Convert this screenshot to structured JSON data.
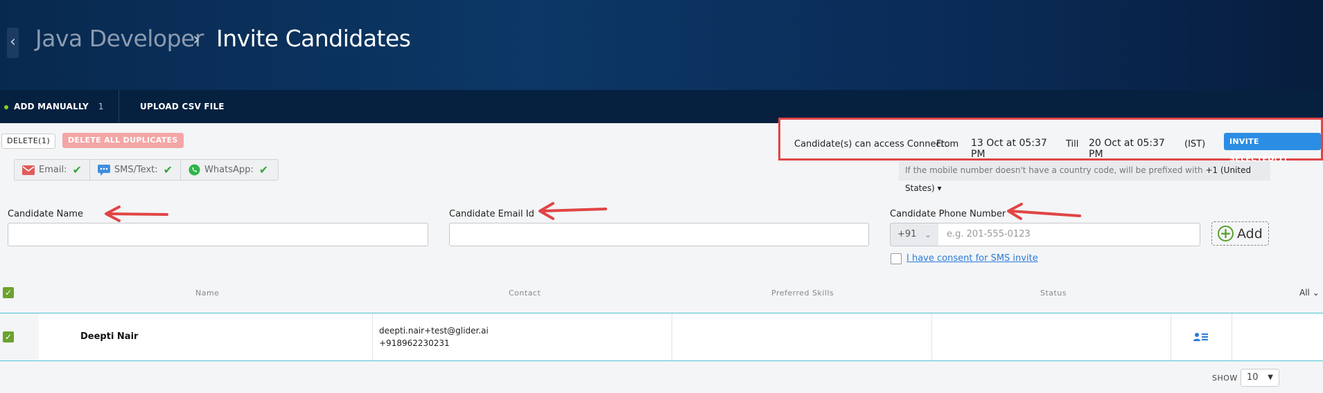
{
  "header": {
    "back_glyph": "‹",
    "breadcrumb_parent": "Java Developer",
    "breadcrumb_separator": "›",
    "page_title": "Invite Candidates"
  },
  "tabs": {
    "add_manually_label": "ADD MANUALLY",
    "add_manually_count": "1",
    "upload_csv_label": "UPLOAD CSV FILE"
  },
  "toolbar": {
    "delete_label": "DELETE(1)",
    "delete_duplicates_label": "DELETE ALL DUPLICATES"
  },
  "channels": [
    {
      "label": "Email:",
      "enabled": true
    },
    {
      "label": "SMS/Text:",
      "enabled": true
    },
    {
      "label": "WhatsApp:",
      "enabled": true
    }
  ],
  "access": {
    "label": "Candidate(s) can access Connect:",
    "from_label": "From",
    "from_value": "13 Oct at 05:37 PM",
    "till_label": "Till",
    "till_value": "20 Oct at 05:37 PM",
    "timezone": "(IST)",
    "invite_button": "INVITE SELECTED(1)"
  },
  "mobile_note": {
    "text": "If the mobile number doesn't have a country code, will be prefixed with",
    "country": "+1 (United States)"
  },
  "form": {
    "name_label": "Candidate Name",
    "name_value": "",
    "email_label": "Candidate Email Id",
    "email_value": "",
    "phone_label": "Candidate Phone Number",
    "country_code": "+91",
    "phone_placeholder": "e.g. 201-555-0123",
    "add_label": "Add",
    "consent_label": "I have consent for SMS invite"
  },
  "table": {
    "columns": [
      "Name",
      "Contact",
      "Preferred Skills",
      "Status"
    ],
    "filter_label": "All",
    "rows": [
      {
        "name": "Deepti Nair",
        "email": "deepti.nair+test@glider.ai",
        "phone": "+918962230231",
        "preferred_skills": "",
        "status": "",
        "selected": true
      }
    ]
  },
  "pagination": {
    "show_label": "SHOW",
    "page_size": "10"
  },
  "colors": {
    "accent_blue": "#2b8de4",
    "highlight_red": "#e04545",
    "check_green": "#6ba32e",
    "header_navy": "#0c3766"
  }
}
